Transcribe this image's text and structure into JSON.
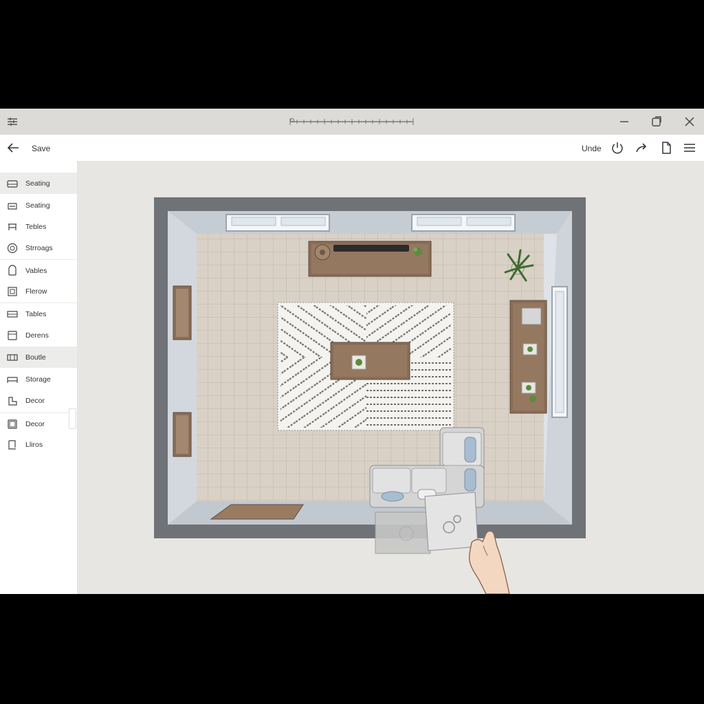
{
  "toolbar": {
    "save_label": "Save",
    "undo_label": "Unde"
  },
  "sidebar": {
    "items": [
      {
        "label": "Seating",
        "icon": "sofa-icon"
      },
      {
        "label": "Seating",
        "icon": "armchair-icon"
      },
      {
        "label": "Tebles",
        "icon": "table-icon"
      },
      {
        "label": "Strroags",
        "icon": "round-table-icon"
      },
      {
        "label": "Vables",
        "icon": "chair-icon"
      },
      {
        "label": "Flerow",
        "icon": "frame-icon"
      },
      {
        "label": "Tables",
        "icon": "desk-icon"
      },
      {
        "label": "Derens",
        "icon": "cabinet-icon"
      },
      {
        "label": "Boutle",
        "icon": "bench-icon"
      },
      {
        "label": "Storage",
        "icon": "shelf-icon"
      },
      {
        "label": "Decor",
        "icon": "lounge-chair-icon"
      },
      {
        "label": "Decor",
        "icon": "mirror-icon"
      },
      {
        "label": "Lliros",
        "icon": "lamp-icon"
      }
    ]
  },
  "colors": {
    "wall": "#6f7378",
    "floor_tile": "#d9d1c6",
    "wood": "#8a6d57",
    "sofa": "#d5d5d5",
    "pillow": "#a9bdd0"
  }
}
